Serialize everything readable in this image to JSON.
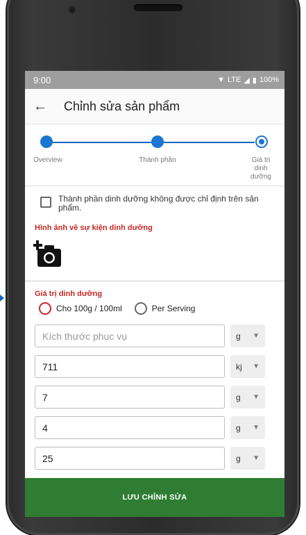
{
  "status": {
    "time": "9:00",
    "lte": "LTE",
    "battery": "100%"
  },
  "appbar": {
    "title": "Chỉnh sửa sản phẩm"
  },
  "stepper": {
    "steps": [
      {
        "label": "Overview"
      },
      {
        "label": "Thành phần"
      },
      {
        "label": "Giá trị\ndinh\ndưỡng"
      }
    ],
    "current_step": 3
  },
  "nutrition_not_specified": {
    "label": "Thành phần dinh dưỡng không được chỉ định trên sản phẩm.",
    "checked": false
  },
  "nutrition_image": {
    "section_title": "Hình ảnh về sự kiện dinh dưỡng",
    "icon": "add-a-photo-icon"
  },
  "nutrition_values": {
    "section_title": "Giá trị dinh dưỡng",
    "per_100": "Cho 100g / 100ml",
    "per_serving": "Per Serving",
    "selected": "per_100"
  },
  "fields": [
    {
      "value": "",
      "placeholder": "Kích thước phục vụ",
      "unit": "g"
    },
    {
      "value": "711",
      "placeholder": "",
      "unit": "kj"
    },
    {
      "value": "7",
      "placeholder": "",
      "unit": "g"
    },
    {
      "value": "4",
      "placeholder": "",
      "unit": "g"
    },
    {
      "value": "25",
      "placeholder": "",
      "unit": "g"
    }
  ],
  "save_button": {
    "label": "LƯU CHỈNH SỬA"
  },
  "colors": {
    "accent": "#1976d2",
    "section_red": "#c62828",
    "save_green": "#2e7d32"
  }
}
